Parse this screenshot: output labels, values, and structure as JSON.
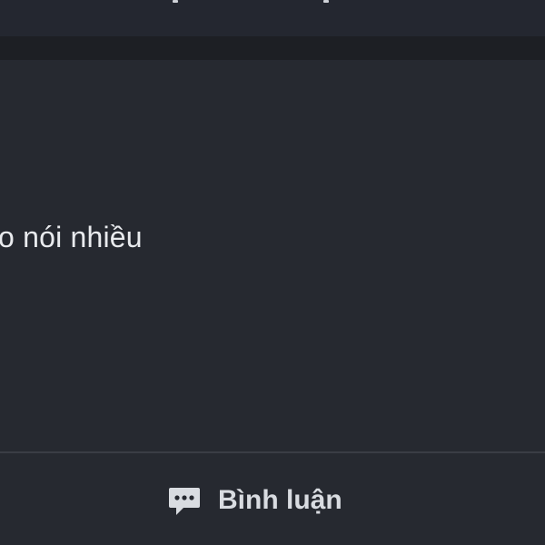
{
  "post": {
    "text": "o nói nhiều"
  },
  "footer": {
    "comment_label": "Bình luận",
    "comment_icon": "chat-bubble-icon"
  },
  "colors": {
    "background": "#262930",
    "separator": "#1d1f24",
    "text": "#e9ebee",
    "icon": "#d9dce1"
  }
}
